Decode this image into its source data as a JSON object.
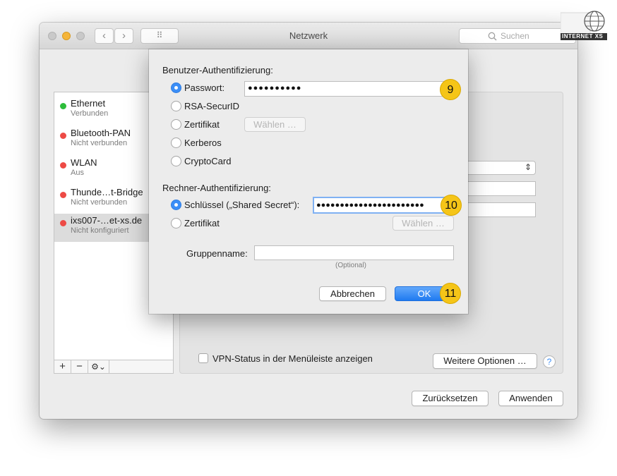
{
  "window": {
    "title": "Netzwerk",
    "search_placeholder": "Suchen",
    "nav_back": "‹",
    "nav_forward": "›",
    "grid_glyph": "⠿"
  },
  "sidebar": {
    "services": [
      {
        "name": "Ethernet",
        "status": "Verbunden",
        "status_color": "#2dbd3a"
      },
      {
        "name": "Bluetooth-PAN",
        "status": "Nicht verbunden",
        "status_color": "#ed4a45"
      },
      {
        "name": "WLAN",
        "status": "Aus",
        "status_color": "#ed4a45"
      },
      {
        "name": "Thunde…t-Bridge",
        "status": "Nicht verbunden",
        "status_color": "#ed4a45"
      },
      {
        "name": "ixs007-…et-xs.de",
        "status": "Nicht konfiguriert",
        "status_color": "#ed4a45"
      }
    ],
    "add_label": "+",
    "remove_label": "−",
    "gear_label": "⚙︎⌄"
  },
  "main": {
    "vpn_status_label": "VPN-Status in der Menüleiste anzeigen",
    "more_options_label": "Weitere Optionen …",
    "help_label": "?",
    "reset_label": "Zurücksetzen",
    "apply_label": "Anwenden"
  },
  "dialog": {
    "user_auth_heading": "Benutzer-Authentifizierung:",
    "user_options": [
      "Passwort:",
      "RSA-SecurID",
      "Zertifikat",
      "Kerberos",
      "CryptoCard"
    ],
    "password_value": "●●●●●●●●●●",
    "choose_label": "Wählen …",
    "machine_auth_heading": "Rechner-Authentifizierung:",
    "machine_options": [
      "Schlüssel („Shared Secret“):",
      "Zertifikat"
    ],
    "shared_secret_value": "●●●●●●●●●●●●●●●●●●●●●●●",
    "group_label": "Gruppenname:",
    "group_value": "",
    "optional_hint": "(Optional)",
    "cancel_label": "Abbrechen",
    "ok_label": "OK"
  },
  "markers": [
    "9",
    "10",
    "11"
  ],
  "logo": {
    "text": "INTERNET XS"
  },
  "colors": {
    "accent": "#3b8ef7",
    "marker": "#f5c518"
  }
}
